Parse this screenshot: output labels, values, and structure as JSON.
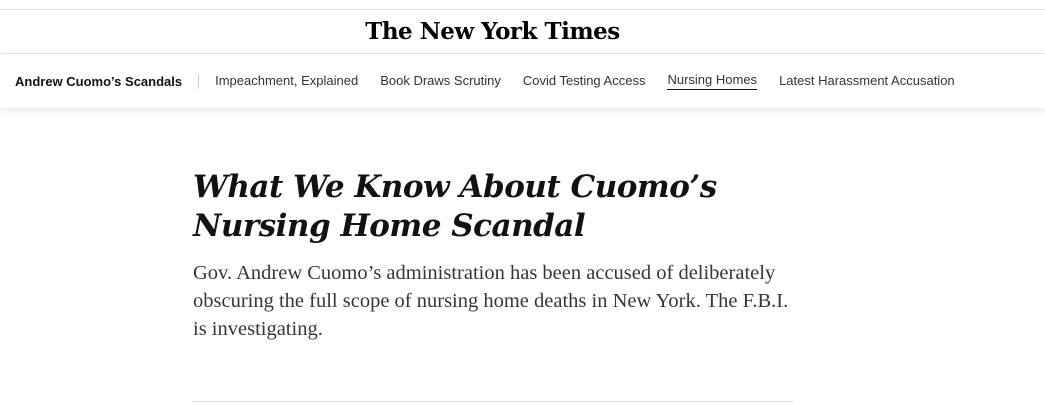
{
  "masthead": {
    "logo_text": "The New York Times"
  },
  "subnav": {
    "section_title": "Andrew Cuomo’s Scandals",
    "items": [
      {
        "label": "Impeachment, Explained",
        "active": false
      },
      {
        "label": "Book Draws Scrutiny",
        "active": false
      },
      {
        "label": "Covid Testing Access",
        "active": false
      },
      {
        "label": "Nursing Homes",
        "active": true
      },
      {
        "label": "Latest Harassment Accusation",
        "active": false
      }
    ]
  },
  "article": {
    "headline": "What We Know About Cuomo’s Nursing Home Scandal",
    "summary": "Gov. Andrew Cuomo’s administration has been accused of deliberately obscuring the full scope of nursing home deaths in New York. The F.B.I. is investigating."
  },
  "colors": {
    "text": "#121212",
    "summary_text": "#363636",
    "rule": "#e2e2e2"
  }
}
